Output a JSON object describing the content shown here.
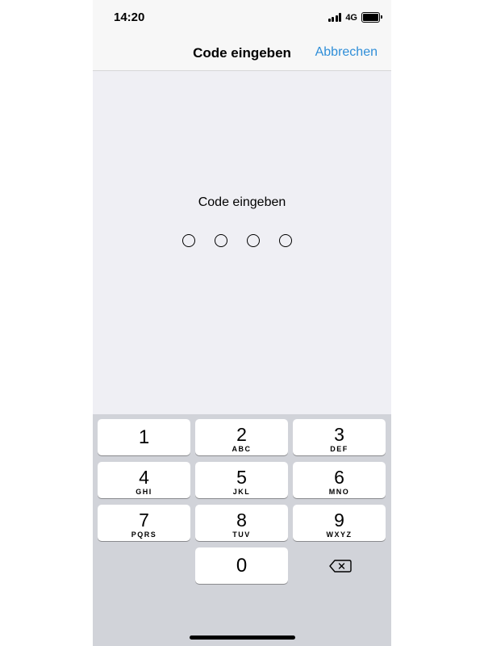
{
  "status_bar": {
    "time": "14:20",
    "network": "4G"
  },
  "nav_bar": {
    "title": "Code eingeben",
    "cancel_label": "Abbrechen"
  },
  "prompt": {
    "text": "Code eingeben",
    "code_length": 4
  },
  "keypad": {
    "keys": [
      {
        "digit": "1",
        "letters": ""
      },
      {
        "digit": "2",
        "letters": "ABC"
      },
      {
        "digit": "3",
        "letters": "DEF"
      },
      {
        "digit": "4",
        "letters": "GHI"
      },
      {
        "digit": "5",
        "letters": "JKL"
      },
      {
        "digit": "6",
        "letters": "MNO"
      },
      {
        "digit": "7",
        "letters": "PQRS"
      },
      {
        "digit": "8",
        "letters": "TUV"
      },
      {
        "digit": "9",
        "letters": "WXYZ"
      },
      {
        "digit": "0",
        "letters": ""
      }
    ],
    "delete_icon": "backspace-icon"
  },
  "colors": {
    "accent": "#2f8ed8",
    "background": "#efeff4",
    "keypad_background": "#d1d3d9"
  }
}
